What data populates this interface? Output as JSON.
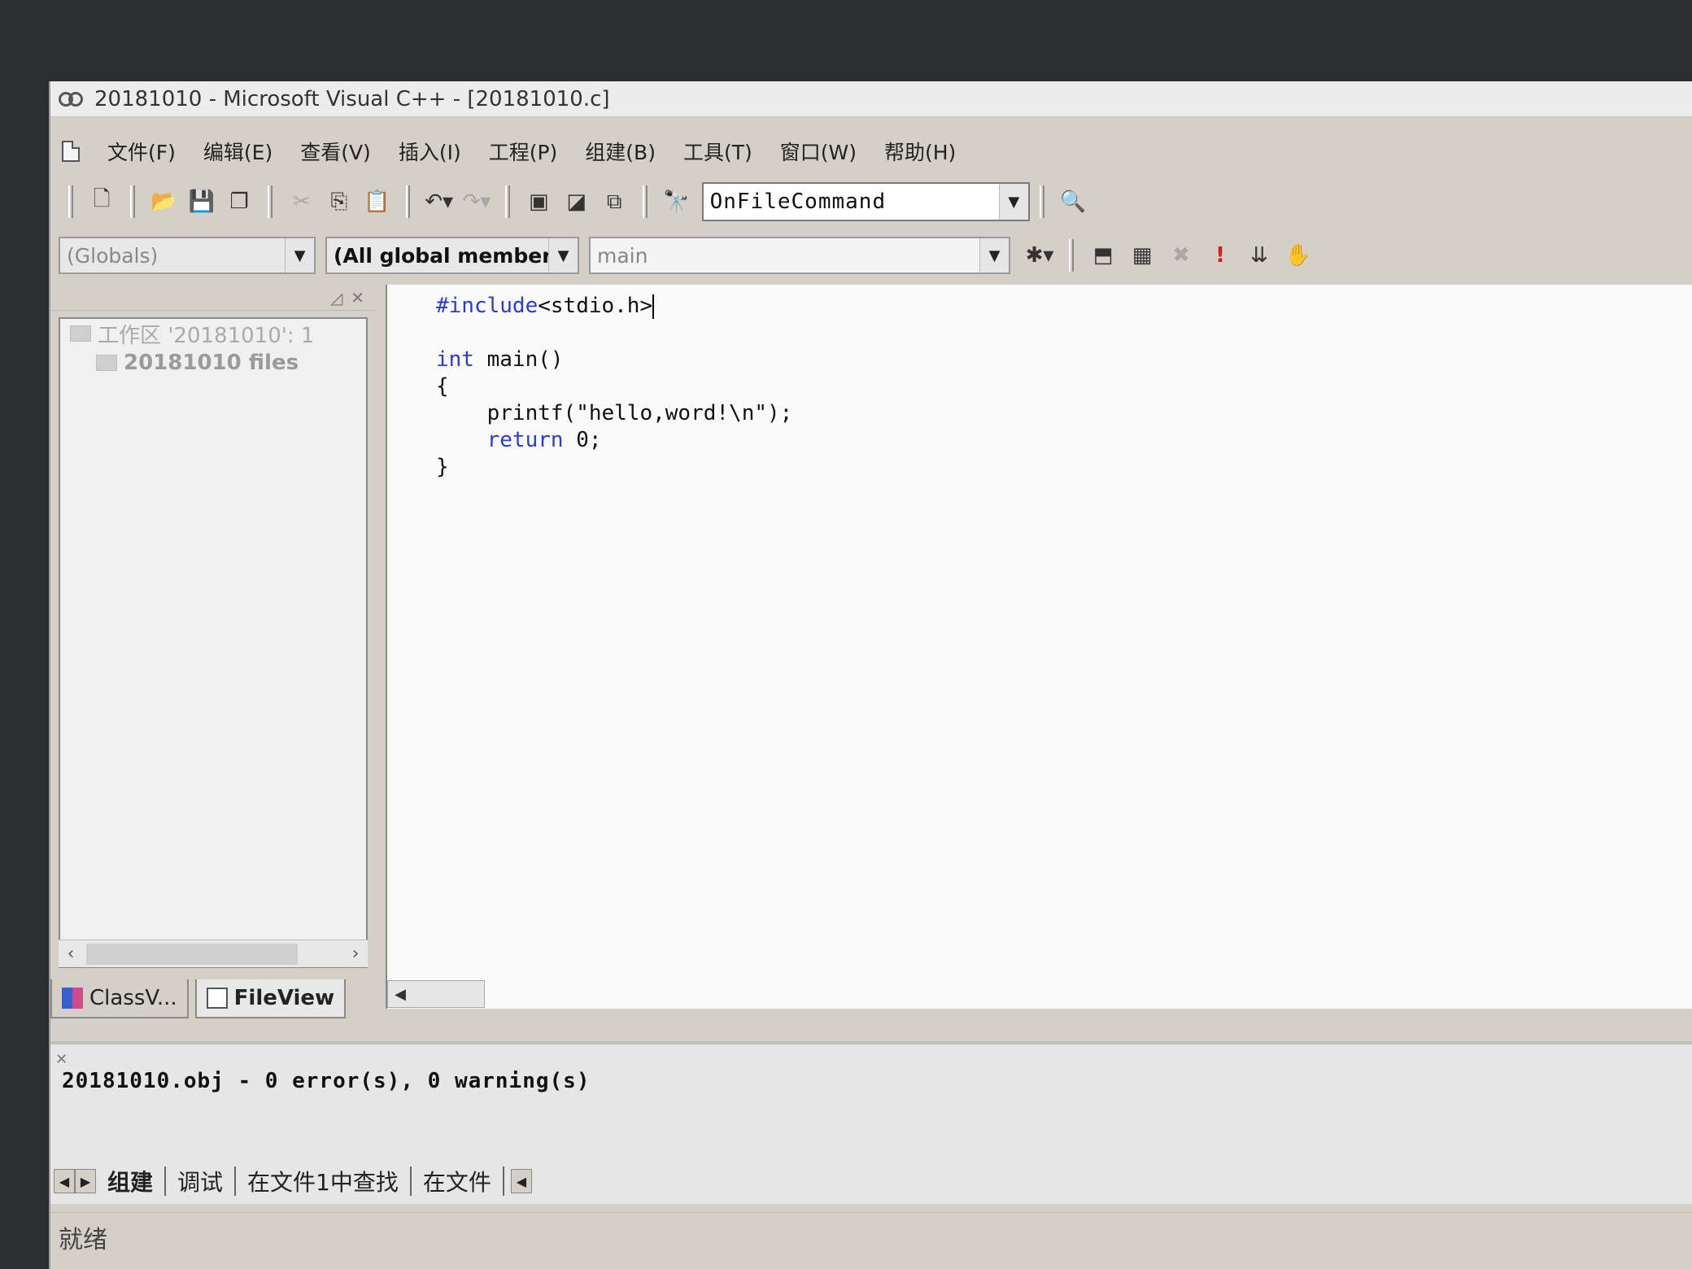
{
  "window": {
    "title": "20181010 - Microsoft Visual C++ - [20181010.c]"
  },
  "menu": [
    "文件(F)",
    "编辑(E)",
    "查看(V)",
    "插入(I)",
    "工程(P)",
    "组建(B)",
    "工具(T)",
    "窗口(W)",
    "帮助(H)"
  ],
  "toolbar": {
    "wizard_combo": "OnFileCommand"
  },
  "wizardbar": {
    "class_combo": "(Globals)",
    "filter_combo": "(All global members",
    "member_combo": "main"
  },
  "workspace": {
    "root": "工作区 '20181010': 1",
    "child": "20181010 files",
    "tabs": [
      "ClassV...",
      "FileView"
    ]
  },
  "editor": {
    "include_directive": "#include",
    "include_target": "<stdio.h>",
    "line_main_kw": "int",
    "line_main_rest": " main()",
    "brace_open": "{",
    "printf_line": "printf(\"hello,word!\\n\");",
    "return_kw": "return",
    "return_rest": " 0;",
    "brace_close": "}"
  },
  "output": {
    "message": "20181010.obj - 0 error(s), 0 warning(s)",
    "tabs": [
      "组建",
      "调试",
      "在文件1中查找",
      "在文件"
    ]
  },
  "status": {
    "text": "就绪"
  }
}
